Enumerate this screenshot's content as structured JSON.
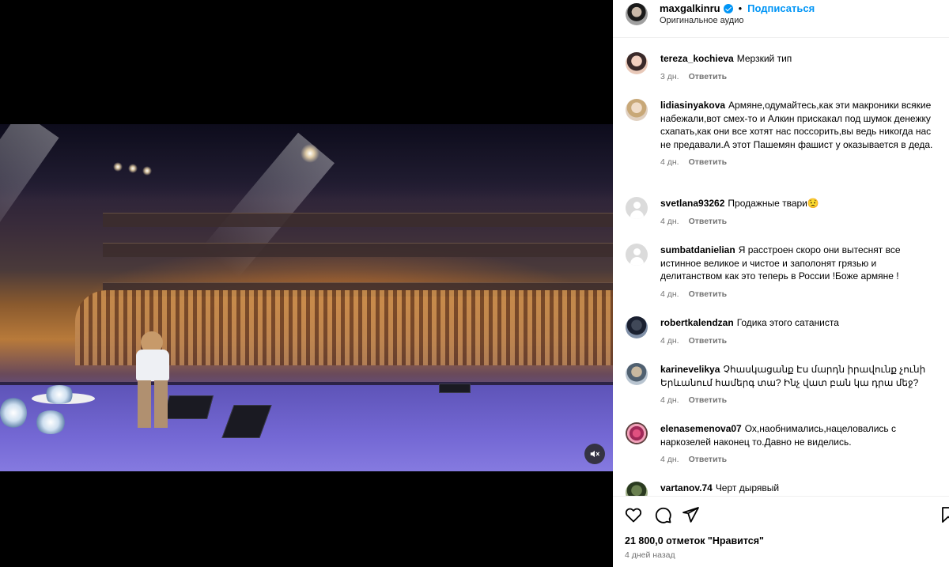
{
  "post": {
    "username": "maxgalkinru",
    "separator": "•",
    "follow_label": "Подписаться",
    "audio_label": "Оригинальное аудио"
  },
  "comments": [
    {
      "username": "tereza_kochieva",
      "text": "Мерзкий тип",
      "time": "3 дн.",
      "reply": "Ответить"
    },
    {
      "username": "lidiasinyakova",
      "text": "Армяне,одумайтесь,как эти макроники всякие набежали,вот смех-то и Алкин прискакал под шумок денежку схапать,как они все хотят нас поссорить,вы ведь никогда нас не предавали.А этот Пашемян фашист у оказывается в деда.",
      "time": "4 дн.",
      "reply": "Ответить"
    },
    {
      "username": "svetlana93262",
      "text": "Продажные твари😟",
      "time": "4 дн.",
      "reply": "Ответить"
    },
    {
      "username": "sumbatdanielian",
      "text": "Я расстроен скоро они вытеснят все истинное великое и чистое и заполонят грязью и делитанством как это теперь в России !Боже армяне !",
      "time": "4 дн.",
      "reply": "Ответить"
    },
    {
      "username": "robertkalendzan",
      "text": "Годика этого сатаниста",
      "time": "4 дн.",
      "reply": "Ответить"
    },
    {
      "username": "karinevelikya",
      "text": "Չհասկացանք Էս մարդն իրավունք չունի Երևանում համերգ տա? Ինչ վատ բան կա դրա մեջ?",
      "time": "4 дн.",
      "reply": "Ответить"
    },
    {
      "username": "elenasemenova07",
      "text": "Ох,наобнимались,нацеловались с наркозелей наконец то.Давно не виделись.",
      "time": "4 дн.",
      "reply": "Ответить"
    },
    {
      "username": "vartanov.74",
      "text": "Черт дырявый",
      "time": "",
      "reply": ""
    }
  ],
  "footer": {
    "likes": "21 800,0 отметок \"Нравится\"",
    "posted": "4 дней назад"
  },
  "icons": {
    "like": "heart-icon",
    "comment": "comment-icon",
    "share": "share-icon",
    "save": "bookmark-icon",
    "mute": "muted-speaker-icon"
  },
  "colors": {
    "accent": "#0095f6",
    "muted_text": "#737373"
  }
}
